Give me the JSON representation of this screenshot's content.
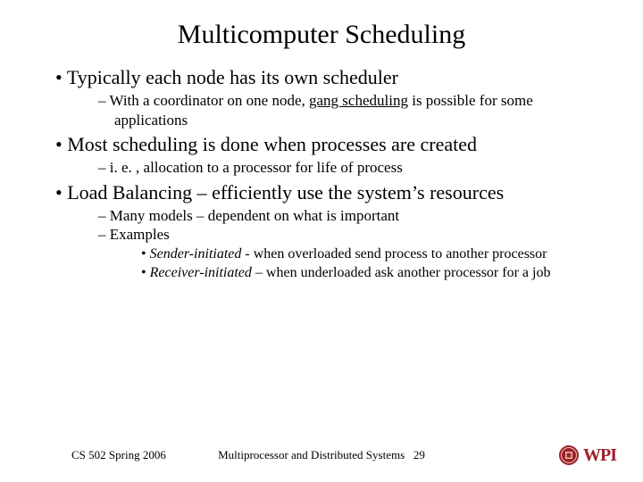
{
  "title": "Multicomputer Scheduling",
  "bullets": {
    "b1": "Typically each node has its own scheduler",
    "b1a_pre": "With a coordinator on one node, ",
    "b1a_em": "gang scheduling",
    "b1a_post": " is possible for some applications",
    "b2": "Most scheduling is done when processes are created",
    "b2a": "i. e. , allocation to a processor for life of process",
    "b3": "Load Balancing – efficiently use the system’s resources",
    "b3a": "Many models – dependent on what is important",
    "b3b": "Examples",
    "b3b1_em": "Sender-initiated ",
    "b3b1_rest": " - when overloaded send process to another processor",
    "b3b2_em": "Receiver-initiated",
    "b3b2_rest": " – when underloaded ask another processor for a job"
  },
  "footer": {
    "left": "CS 502 Spring 2006",
    "center_text": "Multiprocessor and Distributed Systems",
    "slide_num": "29",
    "logo_text": "WPI"
  }
}
